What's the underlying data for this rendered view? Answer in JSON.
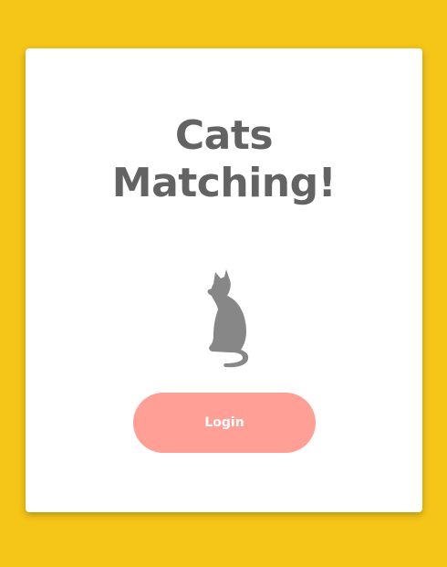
{
  "app": {
    "title_line1": "Cats",
    "title_line2": "Matching!"
  },
  "login": {
    "label": "Login"
  },
  "icons": {
    "cat": "cat-silhouette-icon"
  },
  "colors": {
    "background": "#f5c518",
    "card": "#ffffff",
    "title": "#636363",
    "cat": "#878787",
    "button": "#ff9f96",
    "button_text": "#ffffff"
  }
}
